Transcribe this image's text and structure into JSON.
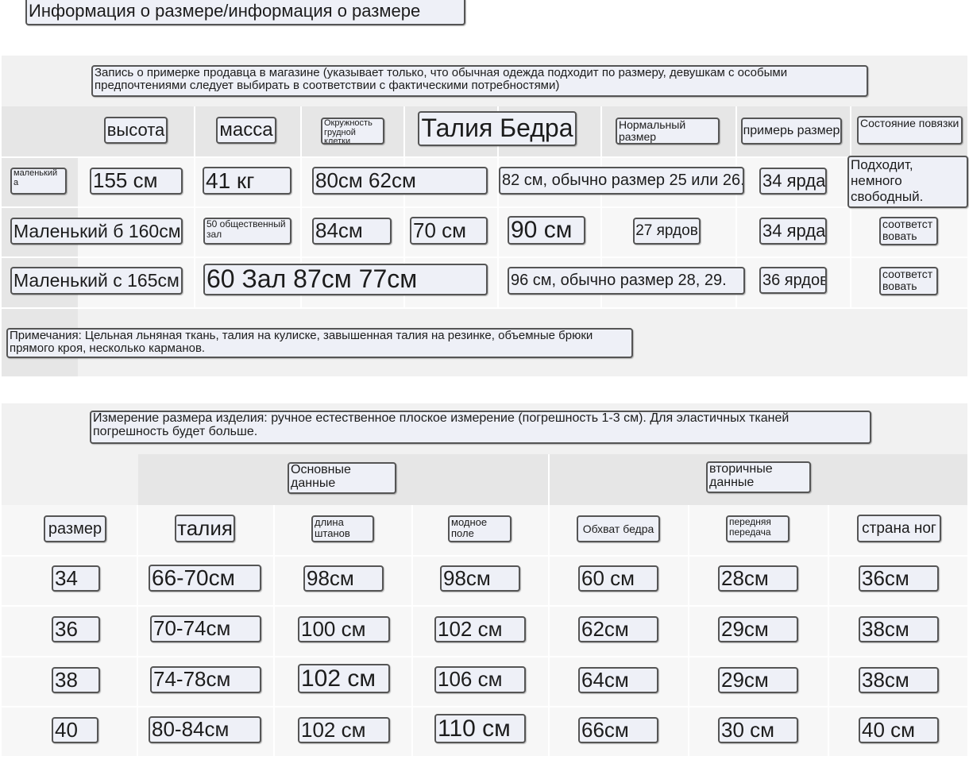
{
  "title": "Информация о размере/информация о размере",
  "fitting": {
    "caption": "Запись о примерке продавца в магазине (указывает только, что обычная одежда подходит по размеру, девушкам с особыми предпочтениями следует выбирать в соответствии с фактическими потребностями)",
    "headers": {
      "height": "высота",
      "weight": "масса",
      "chest": "Окружность грудной клетки",
      "waist_hip": "Талия Бедра",
      "normal_size": "Нормальный размер",
      "try_size": "примерь размер",
      "fit_state": "Состояние повязки"
    },
    "rows": [
      {
        "model": "маленький а",
        "height": "155 см",
        "weight": "41 кг",
        "chest_waist": "80см 62см",
        "hip_normal": "82 см, обычно размер 25 или 26.",
        "try": "34 ярда",
        "state": "Подходит, немного свободный."
      },
      {
        "model": "Маленький б 160см",
        "weight": "50 общественный зал",
        "chest": "84см",
        "waist": "70 см",
        "hip": "90 см",
        "normal": "27 ярдов",
        "try": "34 ярда",
        "state": "соответствовать"
      },
      {
        "model": "Маленький с 165см",
        "weight_chest_waist": "60 Зал 87см 77см",
        "hip_normal": "96 см, обычно размер 28, 29.",
        "try": "36 ярдов",
        "state": "соответствовать"
      }
    ],
    "note": "Примечания: Цельная льняная ткань, талия на кулиске, завышенная талия на резинке, объемные брюки прямого кроя, несколько карманов."
  },
  "product": {
    "caption": "Измерение размера изделия: ручное естественное плоское измерение (погрешность 1-3 см). Для эластичных тканей погрешность будет больше.",
    "group_basic": "Основные данные",
    "group_secondary": "вторичные данные",
    "headers": {
      "size": "размер",
      "waist": "талия",
      "length": "длина штанов",
      "hip": "модное поле",
      "thigh": "Обхват бедра",
      "front_rise": "передняя передача",
      "leg_opening": "страна ног"
    },
    "rows": [
      {
        "size": "34",
        "waist": "66-70см",
        "length": "98см",
        "hip": "98см",
        "thigh": "60 см",
        "rise": "28см",
        "leg": "36см"
      },
      {
        "size": "36",
        "waist": "70-74см",
        "length": "100 см",
        "hip": "102 см",
        "thigh": "62см",
        "rise": "29см",
        "leg": "38см"
      },
      {
        "size": "38",
        "waist": "74-78см",
        "length": "102 см",
        "hip": "106 см",
        "thigh": "64см",
        "rise": "29см",
        "leg": "38см"
      },
      {
        "size": "40",
        "waist": "80-84см",
        "length": "102 см",
        "hip": "110 см",
        "thigh": "66см",
        "rise": "30 см",
        "leg": "40 см"
      }
    ]
  }
}
